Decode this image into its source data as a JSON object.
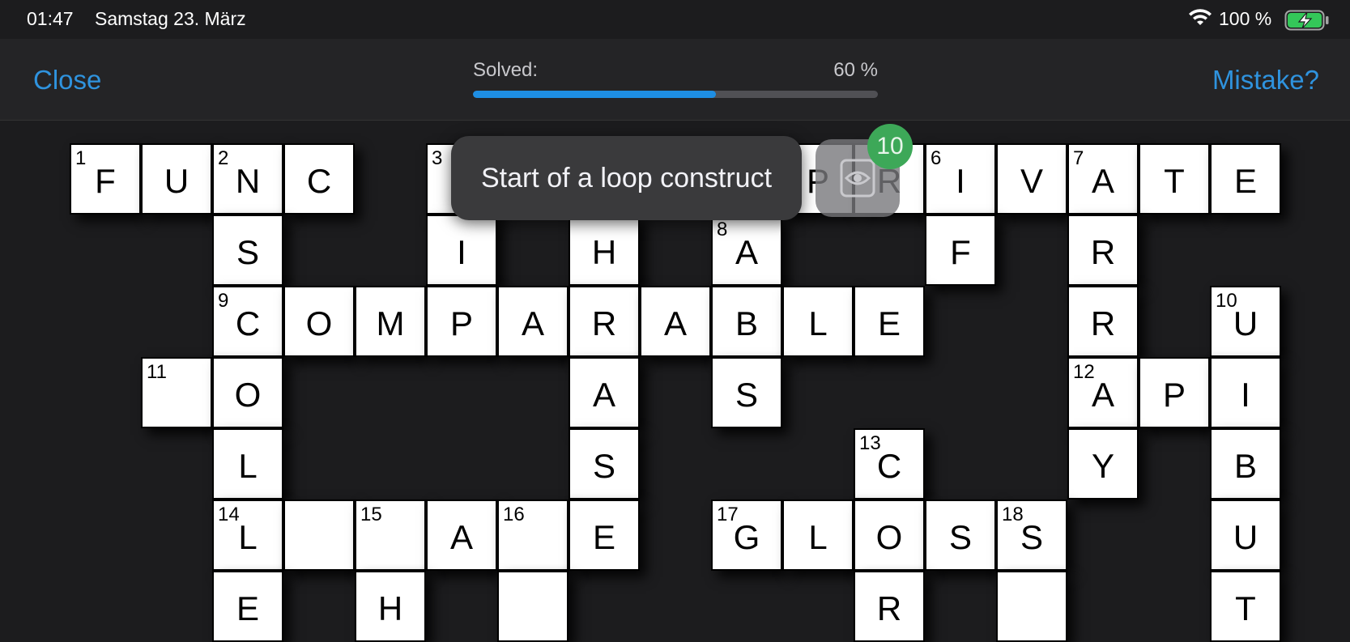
{
  "status": {
    "time": "01:47",
    "date": "Samstag 23. März",
    "battery": "100 %"
  },
  "nav": {
    "close_label": "Close",
    "mistake_label": "Mistake?",
    "solved_label": "Solved:",
    "solved_pct_label": "60 %",
    "progress": 0.6
  },
  "tooltip": {
    "text": "Start of a loop construct"
  },
  "hint": {
    "count": "10",
    "icon": "eye-icon"
  },
  "colors": {
    "accent": "#2f93de",
    "progress": "#1e8ee3",
    "badge": "#3da858",
    "background": "#1c1c1e"
  },
  "grid": {
    "cells": [
      {
        "row": 0,
        "col": 0,
        "num": "1",
        "letter": "F"
      },
      {
        "row": 0,
        "col": 1,
        "num": "",
        "letter": "U"
      },
      {
        "row": 0,
        "col": 2,
        "num": "2",
        "letter": "N"
      },
      {
        "row": 0,
        "col": 3,
        "num": "",
        "letter": "C"
      },
      {
        "row": 0,
        "col": 5,
        "num": "3",
        "letter": ""
      },
      {
        "row": 0,
        "col": 10,
        "num": "",
        "letter": "P"
      },
      {
        "row": 0,
        "col": 11,
        "num": "",
        "letter": "R"
      },
      {
        "row": 0,
        "col": 12,
        "num": "6",
        "letter": "I"
      },
      {
        "row": 0,
        "col": 13,
        "num": "",
        "letter": "V"
      },
      {
        "row": 0,
        "col": 14,
        "num": "7",
        "letter": "A"
      },
      {
        "row": 0,
        "col": 15,
        "num": "",
        "letter": "T"
      },
      {
        "row": 0,
        "col": 16,
        "num": "",
        "letter": "E"
      },
      {
        "row": 1,
        "col": 2,
        "num": "",
        "letter": "S"
      },
      {
        "row": 1,
        "col": 5,
        "num": "",
        "letter": "I"
      },
      {
        "row": 1,
        "col": 7,
        "num": "",
        "letter": "H"
      },
      {
        "row": 1,
        "col": 9,
        "num": "8",
        "letter": "A"
      },
      {
        "row": 1,
        "col": 12,
        "num": "",
        "letter": "F"
      },
      {
        "row": 1,
        "col": 14,
        "num": "",
        "letter": "R"
      },
      {
        "row": 2,
        "col": 2,
        "num": "9",
        "letter": "C"
      },
      {
        "row": 2,
        "col": 3,
        "num": "",
        "letter": "O"
      },
      {
        "row": 2,
        "col": 4,
        "num": "",
        "letter": "M"
      },
      {
        "row": 2,
        "col": 5,
        "num": "",
        "letter": "P"
      },
      {
        "row": 2,
        "col": 6,
        "num": "",
        "letter": "A"
      },
      {
        "row": 2,
        "col": 7,
        "num": "",
        "letter": "R"
      },
      {
        "row": 2,
        "col": 8,
        "num": "",
        "letter": "A"
      },
      {
        "row": 2,
        "col": 9,
        "num": "",
        "letter": "B"
      },
      {
        "row": 2,
        "col": 10,
        "num": "",
        "letter": "L"
      },
      {
        "row": 2,
        "col": 11,
        "num": "",
        "letter": "E"
      },
      {
        "row": 2,
        "col": 14,
        "num": "",
        "letter": "R"
      },
      {
        "row": 2,
        "col": 16,
        "num": "10",
        "letter": "U"
      },
      {
        "row": 3,
        "col": 1,
        "num": "11",
        "letter": ""
      },
      {
        "row": 3,
        "col": 2,
        "num": "",
        "letter": "O"
      },
      {
        "row": 3,
        "col": 7,
        "num": "",
        "letter": "A"
      },
      {
        "row": 3,
        "col": 9,
        "num": "",
        "letter": "S"
      },
      {
        "row": 3,
        "col": 14,
        "num": "12",
        "letter": "A"
      },
      {
        "row": 3,
        "col": 15,
        "num": "",
        "letter": "P"
      },
      {
        "row": 3,
        "col": 16,
        "num": "",
        "letter": "I"
      },
      {
        "row": 4,
        "col": 2,
        "num": "",
        "letter": "L"
      },
      {
        "row": 4,
        "col": 7,
        "num": "",
        "letter": "S"
      },
      {
        "row": 4,
        "col": 11,
        "num": "13",
        "letter": "C"
      },
      {
        "row": 4,
        "col": 14,
        "num": "",
        "letter": "Y"
      },
      {
        "row": 4,
        "col": 16,
        "num": "",
        "letter": "B"
      },
      {
        "row": 5,
        "col": 2,
        "num": "14",
        "letter": "L"
      },
      {
        "row": 5,
        "col": 3,
        "num": "",
        "letter": ""
      },
      {
        "row": 5,
        "col": 4,
        "num": "15",
        "letter": ""
      },
      {
        "row": 5,
        "col": 5,
        "num": "",
        "letter": "A"
      },
      {
        "row": 5,
        "col": 6,
        "num": "16",
        "letter": ""
      },
      {
        "row": 5,
        "col": 7,
        "num": "",
        "letter": "E"
      },
      {
        "row": 5,
        "col": 9,
        "num": "17",
        "letter": "G"
      },
      {
        "row": 5,
        "col": 10,
        "num": "",
        "letter": "L"
      },
      {
        "row": 5,
        "col": 11,
        "num": "",
        "letter": "O"
      },
      {
        "row": 5,
        "col": 12,
        "num": "",
        "letter": "S"
      },
      {
        "row": 5,
        "col": 13,
        "num": "18",
        "letter": "S"
      },
      {
        "row": 5,
        "col": 16,
        "num": "",
        "letter": "U"
      },
      {
        "row": 6,
        "col": 2,
        "num": "",
        "letter": "E"
      },
      {
        "row": 6,
        "col": 4,
        "num": "",
        "letter": "H"
      },
      {
        "row": 6,
        "col": 6,
        "num": "",
        "letter": ""
      },
      {
        "row": 6,
        "col": 11,
        "num": "",
        "letter": "R"
      },
      {
        "row": 6,
        "col": 13,
        "num": "",
        "letter": ""
      },
      {
        "row": 6,
        "col": 16,
        "num": "",
        "letter": "T"
      }
    ]
  }
}
